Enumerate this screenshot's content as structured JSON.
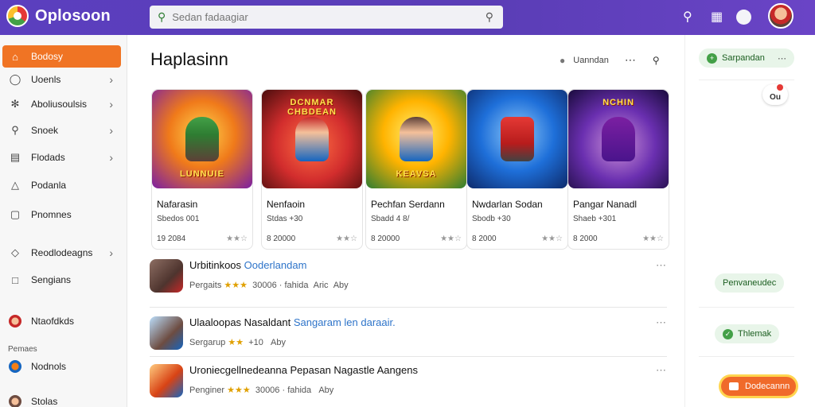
{
  "app": {
    "name": "Oplosoon"
  },
  "search": {
    "placeholder": "Sedan fadaagiar"
  },
  "sidebar": {
    "items": [
      {
        "label": "Bodosy",
        "icon": "home-icon",
        "active": true
      },
      {
        "label": "Uoenls",
        "icon": "user-icon",
        "chevron": true
      },
      {
        "label": "Aboliusoulsis",
        "icon": "sparkle-icon",
        "chevron": true
      },
      {
        "label": "Snoek",
        "icon": "search-icon",
        "chevron": true
      },
      {
        "label": "Flodads",
        "icon": "file-icon",
        "chevron": true
      },
      {
        "label": "Podanla",
        "icon": "person-icon"
      },
      {
        "label": "Pnomnes",
        "icon": "message-icon"
      },
      {
        "label": "Reodlodeagns",
        "icon": "tag-icon",
        "chevron": true
      },
      {
        "label": "Sengians",
        "icon": "square-icon"
      },
      {
        "label": "Ntaofdkds",
        "icon": "avatar-icon"
      }
    ],
    "section_label": "Pemaes",
    "section_items": [
      {
        "label": "Nodnols",
        "icon": "avatar-icon"
      },
      {
        "label": "Stolas",
        "icon": "avatar-icon"
      }
    ]
  },
  "main": {
    "title": "Haplasinn",
    "tools_label": "Uanndan",
    "cards": [
      {
        "name": "Nafarasin",
        "meta": "Sbedos 001",
        "date": "19 2084",
        "caption": "LUNNUIE",
        "caption_top": false,
        "hue": "#f07a1a"
      },
      {
        "name": "Nenfaoin",
        "meta": "Stdas +30",
        "date": "8 20000",
        "caption": "DCNMAR CHBDEAN",
        "caption_top": true,
        "hue": "#d22d2d"
      },
      {
        "name": "Pechfan Serdann",
        "meta": "Sbadd 4 8/",
        "date": "8 20000",
        "caption": "KEAVSA",
        "caption_top": false,
        "hue": "#ffb300"
      },
      {
        "name": "Nwdarlan Sodan",
        "meta": "Sbodb +30",
        "date": "8 2000",
        "caption": "",
        "caption_top": false,
        "hue": "#1e6fd9"
      },
      {
        "name": "Pangar Nanadl",
        "meta": "Shaeb +301",
        "date": "8 2000",
        "caption": "NCHIN",
        "caption_top": true,
        "hue": "#6a2fb0"
      }
    ],
    "list": [
      {
        "title": "Urbitinkoos",
        "link": "Ooderlandam",
        "meta_a": "Pergaits",
        "stars": "★★★",
        "meta_b": "30006 · fahida",
        "meta_c": "Aric",
        "meta_d": "Aby",
        "hue": "#8d6e63"
      },
      {
        "title": "Ulaaloopas Nasaldant",
        "link": "Sangaram len daraair.",
        "meta_a": "Sergarup",
        "stars": "★★",
        "meta_b": "+10",
        "meta_c": "",
        "meta_d": "Aby",
        "hue": "#6d4c41"
      },
      {
        "title": "Uroniecgellnedeanna Pepasan Nagastle Aangens",
        "link": "",
        "meta_a": "Penginer",
        "stars": "★★★",
        "meta_b": "30006 · fahida",
        "meta_c": "",
        "meta_d": "Aby",
        "hue": "#d84315"
      }
    ]
  },
  "right_panel": {
    "top_pill": "Sarpandan",
    "badge": "Ou",
    "pill_2": "Penvaneudec",
    "pill_3": "Thlemak",
    "cta": "Dodecannn"
  }
}
